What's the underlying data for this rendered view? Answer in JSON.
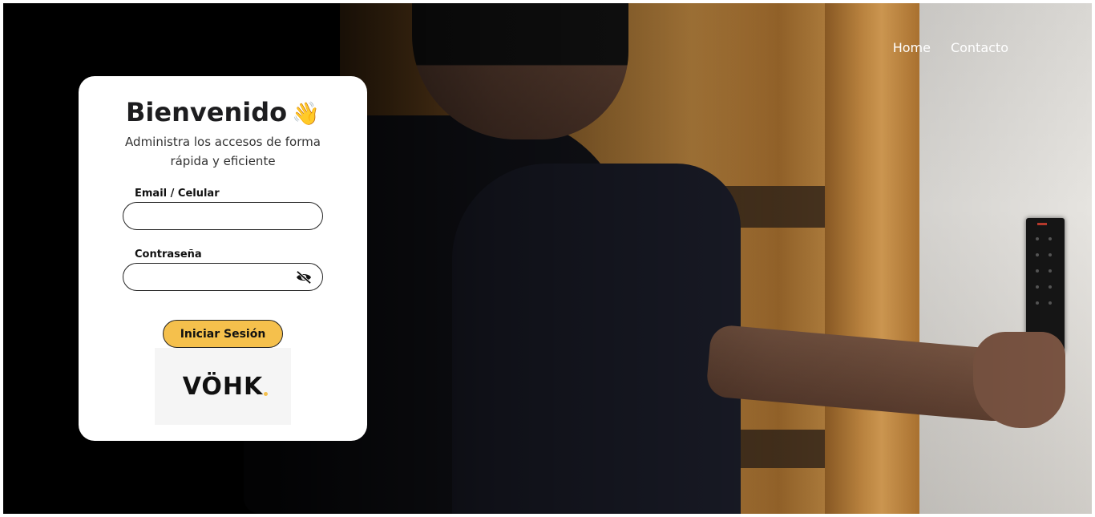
{
  "nav": {
    "home": "Home",
    "contact": "Contacto"
  },
  "login": {
    "title": "Bienvenido",
    "title_emoji": "👋",
    "subtitle": "Administra los accesos de forma rápida y eficiente",
    "email_label": "Email / Celular",
    "email_value": "",
    "password_label": "Contraseña",
    "password_value": "",
    "submit_label": "Iniciar Sesión"
  },
  "brand": {
    "logo_text": "VÖHK",
    "accent_color": "#f5c04c"
  },
  "icons": {
    "password_toggle": "eye-slash-icon"
  }
}
